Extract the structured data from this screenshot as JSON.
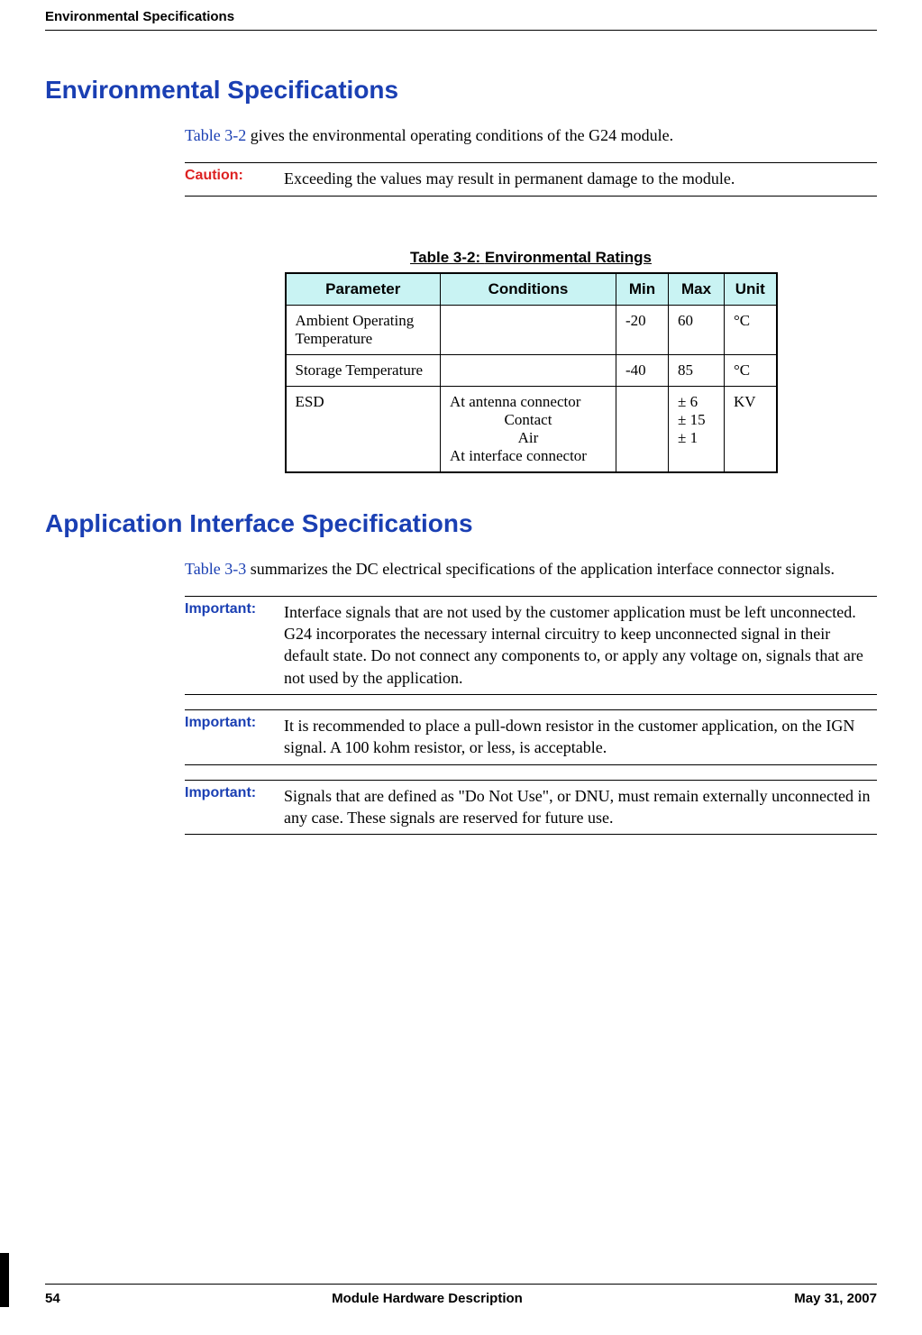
{
  "running_header": "Environmental Specifications",
  "section1": {
    "heading": "Environmental Specifications",
    "intro_link": "Table 3-2",
    "intro_rest": " gives the environmental operating conditions of the G24 module.",
    "caution_label": "Caution:",
    "caution_text": "Exceeding the values may result in permanent damage to the module."
  },
  "table32": {
    "caption_prefix": "Table 3-2: ",
    "caption_title": "Environmental Ratings",
    "headers": {
      "parameter": "Parameter",
      "conditions": "Conditions",
      "min": "Min",
      "max": "Max",
      "unit": "Unit"
    },
    "rows": [
      {
        "parameter": "Ambient Operating Temperature",
        "conditions": "",
        "min": "-20",
        "max": "60",
        "unit": "°C"
      },
      {
        "parameter": "Storage Temperature",
        "conditions": "",
        "min": "-40",
        "max": "85",
        "unit": "°C"
      }
    ],
    "esd": {
      "parameter": "ESD",
      "cond_line1": "At antenna connector",
      "cond_contact": "Contact",
      "cond_air": "Air",
      "cond_line2": "At interface connector",
      "max_line1": "",
      "max_contact": "± 6",
      "max_air": "± 15",
      "max_iface": "± 1",
      "unit": "KV"
    }
  },
  "section2": {
    "heading": "Application Interface Specifications",
    "intro_link": "Table 3-3",
    "intro_rest": " summarizes the DC electrical specifications of the application interface connector signals.",
    "important_label": "Important:",
    "notes": [
      "Interface signals that are not used by the customer application must be left unconnected. G24 incorporates the necessary internal circuitry to keep unconnected signal in their default state. Do not connect any components to, or apply any voltage on, signals that are not used by the application.",
      "It is recommended to place a pull-down resistor in the customer application, on the IGN signal. A 100 kohm resistor, or less, is acceptable.",
      "Signals that are defined as \"Do Not Use\", or DNU, must remain externally unconnected in any case. These signals are reserved for future use."
    ]
  },
  "footer": {
    "page": "54",
    "center": "Module Hardware Description",
    "date": "May 31, 2007"
  },
  "chart_data": {
    "type": "table",
    "title": "Table 3-2: Environmental Ratings",
    "columns": [
      "Parameter",
      "Conditions",
      "Min",
      "Max",
      "Unit"
    ],
    "rows": [
      [
        "Ambient Operating Temperature",
        "",
        -20,
        60,
        "°C"
      ],
      [
        "Storage Temperature",
        "",
        -40,
        85,
        "°C"
      ],
      [
        "ESD",
        "At antenna connector — Contact",
        null,
        "± 6",
        "KV"
      ],
      [
        "ESD",
        "At antenna connector — Air",
        null,
        "± 15",
        "KV"
      ],
      [
        "ESD",
        "At interface connector",
        null,
        "± 1",
        "KV"
      ]
    ]
  }
}
